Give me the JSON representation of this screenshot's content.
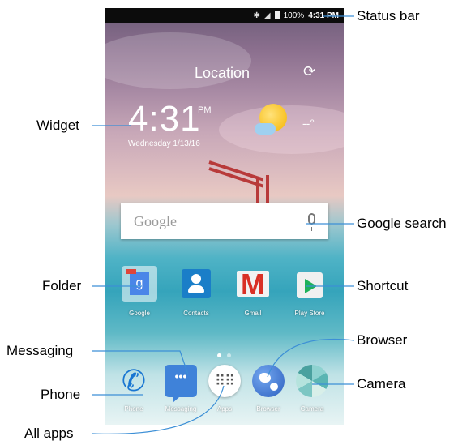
{
  "status_bar": {
    "battery": "100%",
    "time": "4:31 PM"
  },
  "widget": {
    "location": "Location",
    "time": "4:31",
    "ampm": "PM",
    "date": "Wednesday 1/13/16",
    "temperature": "--°"
  },
  "search": {
    "logo": "Google"
  },
  "home_apps": [
    {
      "label": "Google",
      "icon": "google-folder-icon"
    },
    {
      "label": "Contacts",
      "icon": "contacts-icon"
    },
    {
      "label": "Gmail",
      "icon": "gmail-icon"
    },
    {
      "label": "Play Store",
      "icon": "play-store-icon"
    }
  ],
  "dock": [
    {
      "label": "Phone",
      "icon": "phone-icon"
    },
    {
      "label": "Messaging",
      "icon": "messaging-icon"
    },
    {
      "label": "Apps",
      "icon": "all-apps-icon"
    },
    {
      "label": "Browser",
      "icon": "browser-icon"
    },
    {
      "label": "Camera",
      "icon": "camera-icon"
    }
  ],
  "callouts": {
    "status_bar": "Status bar",
    "widget": "Widget",
    "google_search": "Google search",
    "folder": "Folder",
    "shortcut": "Shortcut",
    "messaging": "Messaging",
    "browser": "Browser",
    "phone": "Phone",
    "camera": "Camera",
    "all_apps": "All  apps"
  },
  "colors": {
    "callout_line": "#3c8fd6",
    "status_bar_bg": "#0c0c0c"
  }
}
